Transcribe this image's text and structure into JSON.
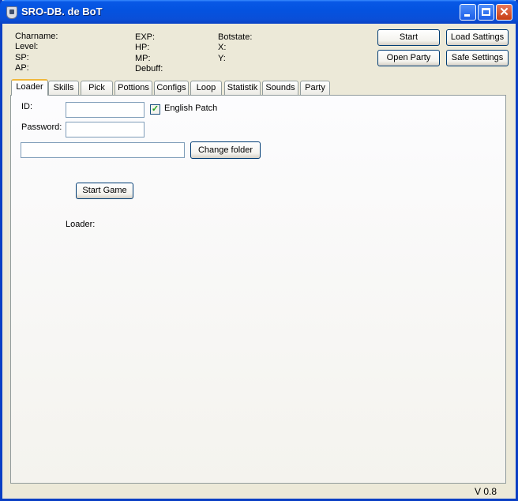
{
  "window": {
    "title": "SRO-DB. de BoT",
    "version": "V 0.8",
    "icons": {
      "app": "app-shield-icon",
      "minimize": "minimize-icon",
      "maximize": "maximize-icon",
      "close": "close-icon"
    },
    "colors": {
      "titlebar": "#0858e6",
      "face": "#ece9d8",
      "active_tab_accent": "#f0b73c",
      "check": "#21a121"
    }
  },
  "status": {
    "col1": [
      "Charname:",
      "Level:",
      "SP:",
      "AP:"
    ],
    "col2": [
      "EXP:",
      "HP:",
      "MP:",
      "Debuff:"
    ],
    "col3": [
      "Botstate:",
      "X:",
      "Y:"
    ]
  },
  "buttons": {
    "start": "Start",
    "load_settings": "Load Sattings",
    "open_party": "Open Party",
    "safe_settings": "Safe Settings"
  },
  "tabs": [
    "Loader",
    "Skills",
    "Pick",
    "Pottions",
    "Configs",
    "Loop",
    "Statistik",
    "Sounds",
    "Party"
  ],
  "active_tab": "Loader",
  "loader": {
    "id_label": "ID:",
    "id_value": "",
    "password_label": "Password:",
    "password_value": "",
    "english_patch_label": "English Patch",
    "english_patch_checked": true,
    "check_glyph": "✓",
    "folder_value": "",
    "change_folder_label": "Change folder",
    "start_game_label": "Start Game",
    "loader_status_label": "Loader:"
  }
}
